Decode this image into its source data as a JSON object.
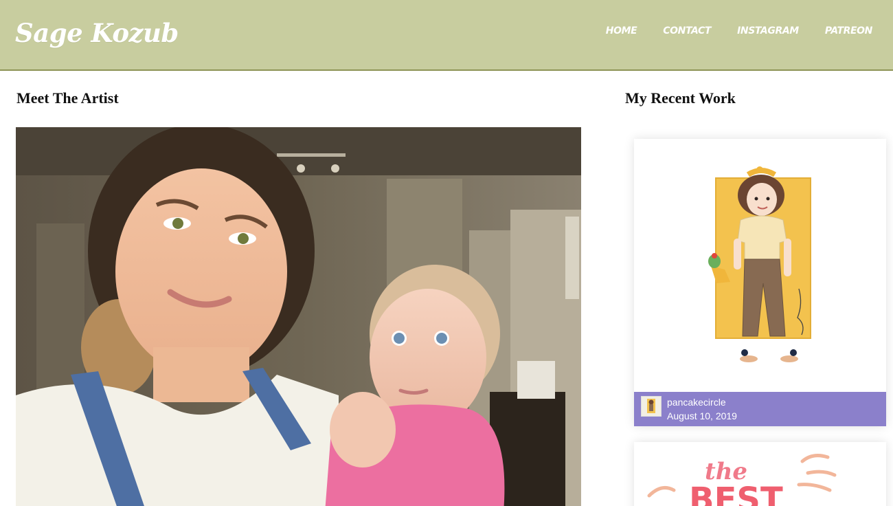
{
  "header": {
    "brand": "Sage Kozub",
    "nav": [
      "HOME",
      "CONTACT",
      "INSTAGRAM",
      "PATREON"
    ]
  },
  "main": {
    "heading": "Meet The Artist"
  },
  "sidebar": {
    "heading": "My Recent Work",
    "posts": [
      {
        "user": "pancakecircle",
        "date": "August 10, 2019"
      }
    ],
    "second_post_art_text": [
      "the",
      "BEST"
    ]
  },
  "colors": {
    "header_bg": "#c8cd9f",
    "header_border": "#8e9456",
    "card_footer": "#8b80cb",
    "art_panel": "#f3c24e"
  }
}
